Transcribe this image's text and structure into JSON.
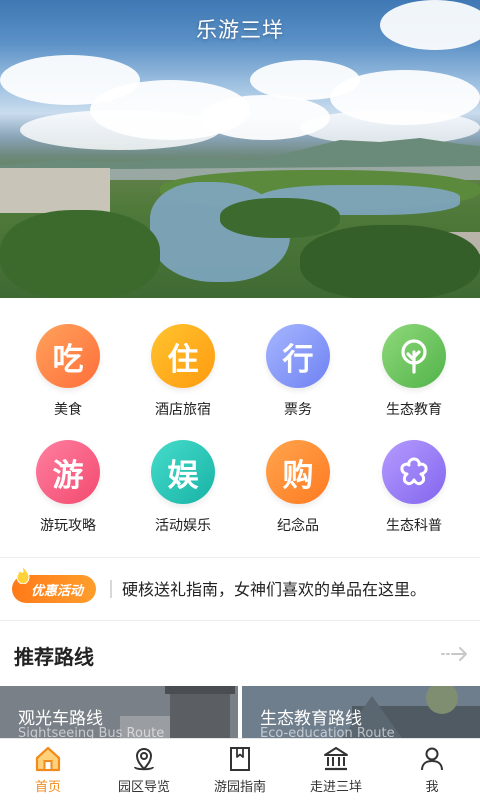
{
  "header": {
    "title": "乐游三垟"
  },
  "categories": [
    {
      "glyph": "吃",
      "label": "美食",
      "icon": "eat-icon",
      "color_from": "#ffa25c",
      "color_to": "#ff6e3a"
    },
    {
      "glyph": "住",
      "label": "酒店旅宿",
      "icon": "stay-icon",
      "color_from": "#ffc42e",
      "color_to": "#ff9a10"
    },
    {
      "glyph": "行",
      "label": "票务",
      "icon": "travel-icon",
      "color_from": "#a6b6ff",
      "color_to": "#6f82f2"
    },
    {
      "glyph": "",
      "label": "生态教育",
      "icon": "tree-icon",
      "color_from": "#8fd97a",
      "color_to": "#52b34a"
    },
    {
      "glyph": "游",
      "label": "游玩攻略",
      "icon": "play-icon",
      "color_from": "#ff7fa0",
      "color_to": "#f24a6e"
    },
    {
      "glyph": "娱",
      "label": "活动娱乐",
      "icon": "fun-icon",
      "color_from": "#46dccb",
      "color_to": "#18b3a6"
    },
    {
      "glyph": "购",
      "label": "纪念品",
      "icon": "shop-icon",
      "color_from": "#ffa54d",
      "color_to": "#ff7a21"
    },
    {
      "glyph": "",
      "label": "生态科普",
      "icon": "flower-icon",
      "color_from": "#b59bff",
      "color_to": "#8266ee"
    }
  ],
  "promo": {
    "badge": "优惠活动",
    "text": "硬核送礼指南，女神们喜欢的单品在这里。"
  },
  "recommend": {
    "title": "推荐路线",
    "routes": [
      {
        "name": "观光车路线",
        "subtitle": "Sightseeing Bus Route"
      },
      {
        "name": "生态教育路线",
        "subtitle": "Eco-education Route"
      }
    ]
  },
  "tabs": [
    {
      "label": "首页",
      "icon": "home-icon",
      "active": true
    },
    {
      "label": "园区导览",
      "icon": "location-icon",
      "active": false
    },
    {
      "label": "游园指南",
      "icon": "guide-book-icon",
      "active": false
    },
    {
      "label": "走进三垟",
      "icon": "museum-icon",
      "active": false
    },
    {
      "label": "我",
      "icon": "user-icon",
      "active": false
    }
  ],
  "colors": {
    "accent": "#f28b1d",
    "promo": "#ff8a24"
  }
}
